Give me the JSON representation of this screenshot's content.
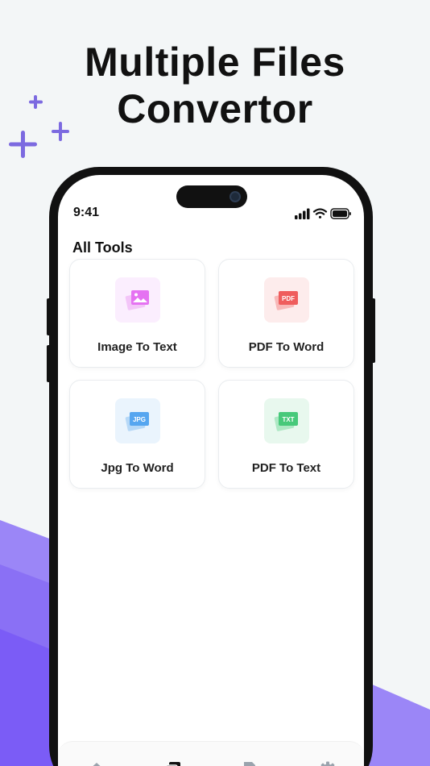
{
  "headline": {
    "line1": "Multiple Files",
    "line2": "Convertor"
  },
  "status_bar": {
    "time": "9:41"
  },
  "page": {
    "title": "All Tools"
  },
  "tools": [
    {
      "label": "Image To Text",
      "icon": "image-icon",
      "badge": "",
      "accent": "#e572f2",
      "tint": "#fbeefe"
    },
    {
      "label": "PDF To Word",
      "icon": "pdf-icon",
      "badge": "PDF",
      "accent": "#ef5d5d",
      "tint": "#fdecec"
    },
    {
      "label": "Jpg To Word",
      "icon": "jpg-icon",
      "badge": "JPG",
      "accent": "#56a6f0",
      "tint": "#eaf4fd"
    },
    {
      "label": "PDF To Text",
      "icon": "txt-icon",
      "badge": "TXT",
      "accent": "#47c97a",
      "tint": "#e8f8ee"
    }
  ],
  "bottom_nav": [
    {
      "name": "home",
      "icon": "home-icon",
      "active": false
    },
    {
      "name": "tools",
      "icon": "add-file-icon",
      "active": true
    },
    {
      "name": "history",
      "icon": "file-history-icon",
      "active": false
    },
    {
      "name": "settings",
      "icon": "gear-icon",
      "active": false
    }
  ],
  "colors": {
    "brand_purple": "#7b5cf6",
    "sparkle": "#7c6ae0",
    "nav_inactive": "#9aa3ad",
    "nav_active": "#111111"
  }
}
